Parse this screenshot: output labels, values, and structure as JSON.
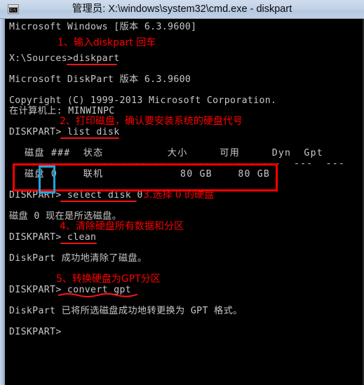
{
  "window": {
    "title": "管理员: X:\\windows\\system32\\cmd.exe - diskpart",
    "icon_name": "cmd-console-icon",
    "icon_glyph": "C:\\",
    "titlebar_color": "#bfd0e6",
    "console_bg": "#000000",
    "console_fg": "#c8c8c8",
    "annotation_color": "#ff0000",
    "highlight_color": "#21a6dd"
  },
  "console": {
    "lines": [
      {
        "id": "version",
        "text": "Microsoft Windows [版本 6.3.9600]"
      },
      {
        "id": "prompt-root",
        "text": "X:\\Sources>diskpart"
      },
      {
        "id": "diskpart-ver",
        "text": "Microsoft DiskPart 版本 6.3.9600"
      },
      {
        "id": "copyright",
        "text": "Copyright (C) 1999-2013 Microsoft Corporation."
      },
      {
        "id": "computer",
        "text": "在计算机上: MINWINPC"
      },
      {
        "id": "cmd-list-disk",
        "text": "DISKPART> list disk"
      },
      {
        "id": "table-header",
        "text": "磁盘 ###  状态          大小     可用     Dyn  Gpt"
      },
      {
        "id": "table-rule",
        "text": "--------  ------------  -------  -------  ---  ---"
      },
      {
        "id": "table-row-0",
        "text": "磁盘 0    联机            80 GB    80 GB"
      },
      {
        "id": "cmd-select",
        "text": "DISKPART> select disk 0"
      },
      {
        "id": "msg-selected",
        "text": "磁盘 0 现在是所选磁盘。"
      },
      {
        "id": "cmd-clean",
        "text": "DISKPART> clean"
      },
      {
        "id": "msg-cleaned",
        "text": "DiskPart 成功地清除了磁盘。"
      },
      {
        "id": "cmd-convert",
        "text": "DISKPART> convert gpt"
      },
      {
        "id": "msg-converted",
        "text": "DiskPart 已将所选磁盘成功地转更换为 GPT 格式。"
      },
      {
        "id": "prompt-final",
        "text": "DISKPART>"
      }
    ],
    "table": {
      "headers": [
        "磁盘 ###",
        "状态",
        "大小",
        "可用",
        "Dyn",
        "Gpt"
      ],
      "rows": [
        {
          "disk": "磁盘 0",
          "status": "联机",
          "size": "80 GB",
          "free": "80 GB",
          "dyn": "",
          "gpt": ""
        }
      ]
    }
  },
  "annotations": [
    {
      "id": "step-1",
      "text": "1、输入diskpart 回车"
    },
    {
      "id": "step-2",
      "text": "2、打印磁盘，确认要安装系统的硬盘代号"
    },
    {
      "id": "step-3",
      "text": "3.选择 0 的硬盘"
    },
    {
      "id": "step-4",
      "text": "4、清除硬盘所有数据和分区"
    },
    {
      "id": "step-5",
      "text": "5、转换硬盘为GPT分区"
    }
  ]
}
